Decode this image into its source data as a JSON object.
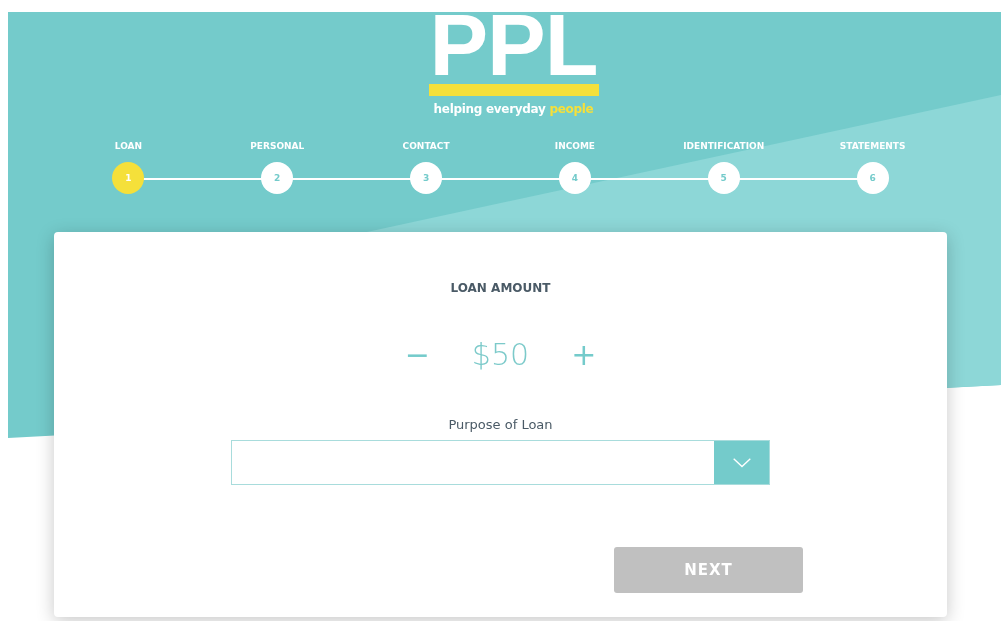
{
  "logo": {
    "wordmark": "PPL",
    "tagline": "helping everyday",
    "tagline_highlight": "people"
  },
  "steps": [
    {
      "label": "LOAN",
      "number": "1",
      "selected": true
    },
    {
      "label": "PERSONAL",
      "number": "2",
      "selected": false
    },
    {
      "label": "CONTACT",
      "number": "3",
      "selected": false
    },
    {
      "label": "INCOME",
      "number": "4",
      "selected": false
    },
    {
      "label": "IDENTIFICATION",
      "number": "5",
      "selected": false
    },
    {
      "label": "STATEMENTS",
      "number": "6",
      "selected": false
    }
  ],
  "loan_amount": {
    "title": "LOAN AMOUNT",
    "decrease": "−",
    "value": "$50",
    "increase": "+"
  },
  "purpose": {
    "label": "Purpose of Loan"
  },
  "next_button": {
    "label": "NEXT",
    "disabled": true
  }
}
